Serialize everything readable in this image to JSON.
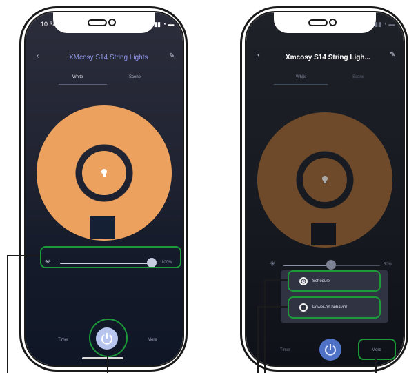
{
  "left_phone": {
    "status_time": "10:34",
    "title": "XMcosy S14 String Lights",
    "tabs": [
      "White",
      "Scene"
    ],
    "brightness_value": "100%",
    "brightness_fraction": 1.0,
    "bottom": {
      "timer": "Timer",
      "more": "More"
    }
  },
  "right_phone": {
    "title": "Xmcosy S14 String Ligh...",
    "tabs": [
      "White",
      "Scene"
    ],
    "brightness_value": "50%",
    "brightness_fraction": 0.5,
    "menu_items": [
      {
        "label": "Schedule",
        "icon": "clock-icon"
      },
      {
        "label": "Power-on behavior",
        "icon": "power-on-icon"
      }
    ],
    "bottom": {
      "timer": "Timer",
      "more": "More"
    }
  },
  "colors": {
    "accent_orange": "#eca15f",
    "highlight_green": "#1c9a3a",
    "screen_bg": "#202331"
  }
}
